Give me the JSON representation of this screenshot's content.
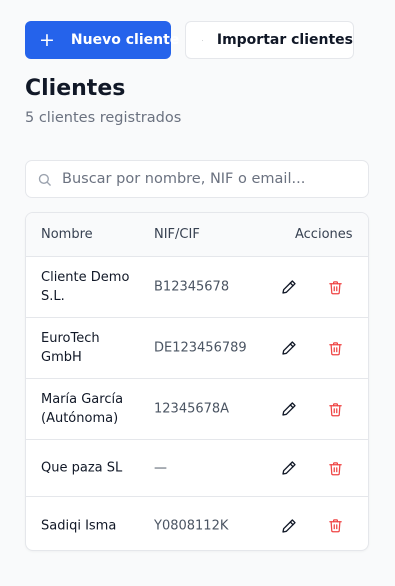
{
  "toolbar": {
    "new_client_label": "Nuevo cliente",
    "import_label": "Importar clientes"
  },
  "page": {
    "title": "Clientes",
    "subtitle": "5 clientes registrados"
  },
  "search": {
    "placeholder": "Buscar por nombre, NIF o email...",
    "value": ""
  },
  "table": {
    "columns": [
      "Nombre",
      "NIF/CIF",
      "Acciones"
    ],
    "rows": [
      {
        "name": "Cliente Demo S.L.",
        "nif": "B12345678"
      },
      {
        "name": "EuroTech GmbH",
        "nif": "DE123456789"
      },
      {
        "name": "María García (Autónoma)",
        "nif": "12345678A"
      },
      {
        "name": "Que paza SL",
        "nif": "—"
      },
      {
        "name": "Sadiqi Isma",
        "nif": "Y0808112K"
      }
    ]
  },
  "icons": {
    "primary_button": "plus-icon",
    "import_button": "upload-icon",
    "search": "search-icon",
    "row_edit": "pencil-icon",
    "row_delete": "trash-icon"
  },
  "colors": {
    "primary": "#2563eb",
    "delete": "#ef4444",
    "background": "#f9fafb",
    "muted_text": "#6b7280"
  }
}
